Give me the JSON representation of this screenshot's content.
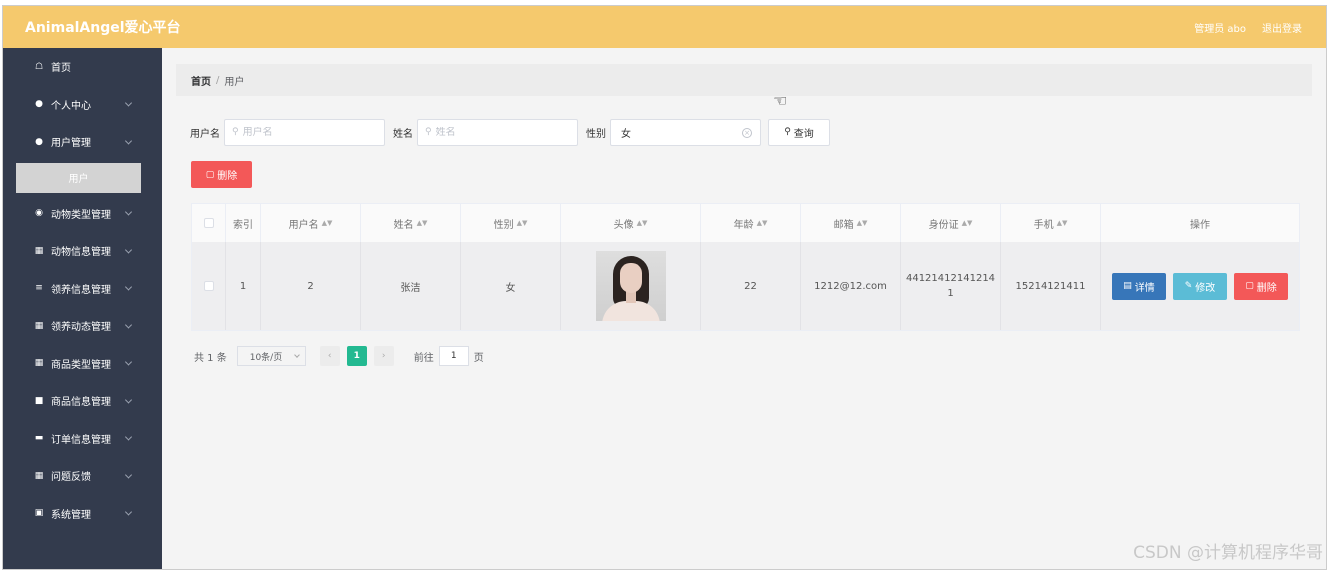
{
  "header": {
    "brand": "AnimalAngel爱心平台",
    "admin_label": "管理员 abo",
    "logout_label": "退出登录"
  },
  "sidebar": {
    "items": [
      {
        "label": "首页",
        "icon": "home-icon",
        "has_children": false
      },
      {
        "label": "个人中心",
        "icon": "user-icon",
        "has_children": true
      },
      {
        "label": "用户管理",
        "icon": "user-icon",
        "has_children": true,
        "expanded": true,
        "children": [
          {
            "label": "用户",
            "active": true
          }
        ]
      },
      {
        "label": "动物类型管理",
        "icon": "pin-icon",
        "has_children": true
      },
      {
        "label": "动物信息管理",
        "icon": "grid-icon",
        "has_children": true
      },
      {
        "label": "领养信息管理",
        "icon": "list-icon",
        "has_children": true
      },
      {
        "label": "领养动态管理",
        "icon": "grid-icon",
        "has_children": true
      },
      {
        "label": "商品类型管理",
        "icon": "grid-icon",
        "has_children": true
      },
      {
        "label": "商品信息管理",
        "icon": "square-icon",
        "has_children": true
      },
      {
        "label": "订单信息管理",
        "icon": "box-icon",
        "has_children": true
      },
      {
        "label": "问题反馈",
        "icon": "grid-icon",
        "has_children": true
      },
      {
        "label": "系统管理",
        "icon": "clipboard-icon",
        "has_children": true
      }
    ]
  },
  "breadcrumb": {
    "home": "首页",
    "separator": "/",
    "current": "用户"
  },
  "search": {
    "username_label": "用户名",
    "username_placeholder": "用户名",
    "name_label": "姓名",
    "name_placeholder": "姓名",
    "gender_label": "性别",
    "gender_value": "女",
    "query_label": "查询"
  },
  "toolbar": {
    "delete_label": "删除"
  },
  "table": {
    "columns": [
      "索引",
      "用户名",
      "姓名",
      "性别",
      "头像",
      "年龄",
      "邮箱",
      "身份证",
      "手机",
      "操作"
    ],
    "rows": [
      {
        "index": "1",
        "username": "2",
        "name": "张洁",
        "gender": "女",
        "age": "22",
        "email": "1212@12.com",
        "id_card": "44121412141214 1",
        "phone": "15214121411"
      }
    ],
    "actions": {
      "detail": "详情",
      "edit": "修改",
      "delete": "删除"
    }
  },
  "pagination": {
    "total": "共 1 条",
    "page_size": "10条/页",
    "current_page": "1",
    "goto_prefix": "前往",
    "goto_value": "1",
    "goto_suffix": "页"
  },
  "watermark": "CSDN @计算机程序华哥"
}
